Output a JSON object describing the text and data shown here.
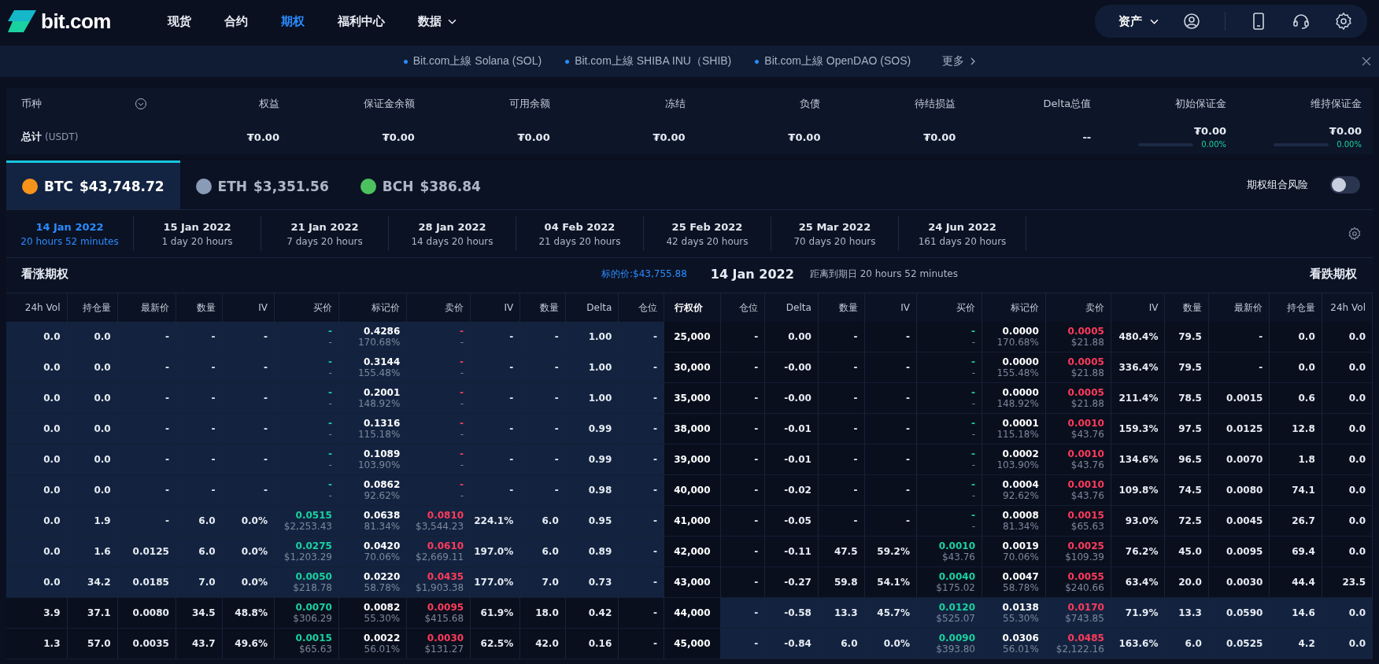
{
  "nav": {
    "logo": "bit.com",
    "items": [
      {
        "label": "现货",
        "selected": false,
        "dropdown": false
      },
      {
        "label": "合约",
        "selected": false,
        "dropdown": false
      },
      {
        "label": "期权",
        "selected": true,
        "dropdown": false
      },
      {
        "label": "福利中心",
        "selected": false,
        "dropdown": false
      },
      {
        "label": "数据",
        "selected": false,
        "dropdown": true
      }
    ],
    "assets": "资产"
  },
  "ticker": {
    "items": [
      "Bit.com上線 Solana (SOL)",
      "Bit.com上線 SHIBA INU（SHIB)",
      "Bit.com上線 OpenDAO (SOS)"
    ],
    "more": "更多"
  },
  "summary": {
    "headers": [
      "币种",
      "权益",
      "保证金余额",
      "可用余额",
      "冻结",
      "负债",
      "待结损益",
      "Delta总值",
      "初始保证金",
      "维持保证金"
    ],
    "total_label": "总计",
    "total_unit": "(USDT)",
    "values": [
      {
        "value": "₮0.00"
      },
      {
        "value": "₮0.00"
      },
      {
        "value": "₮0.00"
      },
      {
        "value": "₮0.00"
      },
      {
        "value": "₮0.00"
      },
      {
        "value": "₮0.00"
      },
      {
        "value": "--"
      },
      {
        "value": "₮0.00",
        "ratio": "0.00%",
        "level": 0
      },
      {
        "value": "₮0.00",
        "ratio": "0.00%",
        "level": 0
      }
    ]
  },
  "currencies": [
    {
      "symbol": "BTC",
      "price": "$43,748.72",
      "selected": true,
      "color": "#f7931a"
    },
    {
      "symbol": "ETH",
      "price": "$3,351.56",
      "selected": false,
      "color": "#8a9bb8"
    },
    {
      "symbol": "BCH",
      "price": "$386.84",
      "selected": false,
      "color": "#4cc25f"
    }
  ],
  "combo_risk": {
    "label": "期权组合风险",
    "on": false
  },
  "expiries": [
    {
      "date": "14 Jan 2022",
      "remaining": "20 hours 52 minutes",
      "selected": true
    },
    {
      "date": "15 Jan 2022",
      "remaining": "1 day 20 hours",
      "selected": false
    },
    {
      "date": "21 Jan 2022",
      "remaining": "7 days 20 hours",
      "selected": false
    },
    {
      "date": "28 Jan 2022",
      "remaining": "14 days 20 hours",
      "selected": false
    },
    {
      "date": "04 Feb 2022",
      "remaining": "21 days 20 hours",
      "selected": false
    },
    {
      "date": "25 Feb 2022",
      "remaining": "42 days 20 hours",
      "selected": false
    },
    {
      "date": "25 Mar 2022",
      "remaining": "70 days 20 hours",
      "selected": false
    },
    {
      "date": "24 Jun 2022",
      "remaining": "161 days 20 hours",
      "selected": false
    }
  ],
  "chain_header": {
    "calls_title": "看涨期权",
    "underlying": "标的价:$43,755.88",
    "expiry": "14 Jan 2022",
    "countdown": "距离到期日 20 hours 52 minutes",
    "puts_title": "看跌期权"
  },
  "call_columns": [
    {
      "label": "24h Vol",
      "kind": "plain"
    },
    {
      "label": "持仓量",
      "kind": "plain"
    },
    {
      "label": "最新价",
      "kind": "plain"
    },
    {
      "label": "数量",
      "kind": "plain"
    },
    {
      "label": "IV",
      "kind": "plain"
    },
    {
      "label": "买价",
      "kind": "bid"
    },
    {
      "label": "标记价",
      "kind": "mark"
    },
    {
      "label": "卖价",
      "kind": "ask"
    },
    {
      "label": "IV",
      "kind": "plain"
    },
    {
      "label": "数量",
      "kind": "plain"
    },
    {
      "label": "Delta",
      "kind": "plain"
    },
    {
      "label": "仓位",
      "kind": "plain"
    }
  ],
  "strike_column": "行权价",
  "put_columns": [
    {
      "label": "仓位",
      "kind": "plain"
    },
    {
      "label": "Delta",
      "kind": "plain"
    },
    {
      "label": "数量",
      "kind": "plain"
    },
    {
      "label": "IV",
      "kind": "plain"
    },
    {
      "label": "买价",
      "kind": "bid"
    },
    {
      "label": "标记价",
      "kind": "mark"
    },
    {
      "label": "卖价",
      "kind": "ask"
    },
    {
      "label": "IV",
      "kind": "plain"
    },
    {
      "label": "数量",
      "kind": "plain"
    },
    {
      "label": "最新价",
      "kind": "plain"
    },
    {
      "label": "持仓量",
      "kind": "plain"
    },
    {
      "label": "24h Vol",
      "kind": "plain"
    }
  ],
  "rows": [
    {
      "strike": "25,000",
      "call_itm": true,
      "put_itm": false,
      "call": [
        "0.0",
        "0.0",
        "-",
        "-",
        "-",
        [
          "-",
          "-"
        ],
        [
          "0.4286",
          "170.68%"
        ],
        [
          "-",
          "-"
        ],
        "-",
        "-",
        "1.00",
        "-"
      ],
      "put": [
        "-",
        "0.00",
        "-",
        "-",
        [
          "-",
          "-"
        ],
        [
          "0.0000",
          "170.68%"
        ],
        [
          "0.0005",
          "$21.88"
        ],
        "480.4%",
        "79.5",
        "-",
        "0.0",
        "0.0"
      ]
    },
    {
      "strike": "30,000",
      "call_itm": true,
      "put_itm": false,
      "call": [
        "0.0",
        "0.0",
        "-",
        "-",
        "-",
        [
          "-",
          "-"
        ],
        [
          "0.3144",
          "155.48%"
        ],
        [
          "-",
          "-"
        ],
        "-",
        "-",
        "1.00",
        "-"
      ],
      "put": [
        "-",
        "-0.00",
        "-",
        "-",
        [
          "-",
          "-"
        ],
        [
          "0.0000",
          "155.48%"
        ],
        [
          "0.0005",
          "$21.88"
        ],
        "336.4%",
        "79.5",
        "-",
        "0.0",
        "0.0"
      ]
    },
    {
      "strike": "35,000",
      "call_itm": true,
      "put_itm": false,
      "call": [
        "0.0",
        "0.0",
        "-",
        "-",
        "-",
        [
          "-",
          "-"
        ],
        [
          "0.2001",
          "148.92%"
        ],
        [
          "-",
          "-"
        ],
        "-",
        "-",
        "1.00",
        "-"
      ],
      "put": [
        "-",
        "-0.00",
        "-",
        "-",
        [
          "-",
          "-"
        ],
        [
          "0.0000",
          "148.92%"
        ],
        [
          "0.0005",
          "$21.88"
        ],
        "211.4%",
        "78.5",
        "0.0015",
        "0.6",
        "0.0"
      ]
    },
    {
      "strike": "38,000",
      "call_itm": true,
      "put_itm": false,
      "call": [
        "0.0",
        "0.0",
        "-",
        "-",
        "-",
        [
          "-",
          "-"
        ],
        [
          "0.1316",
          "115.18%"
        ],
        [
          "-",
          "-"
        ],
        "-",
        "-",
        "0.99",
        "-"
      ],
      "put": [
        "-",
        "-0.01",
        "-",
        "-",
        [
          "-",
          "-"
        ],
        [
          "0.0001",
          "115.18%"
        ],
        [
          "0.0010",
          "$43.76"
        ],
        "159.3%",
        "97.5",
        "0.0125",
        "12.8",
        "0.0"
      ]
    },
    {
      "strike": "39,000",
      "call_itm": true,
      "put_itm": false,
      "call": [
        "0.0",
        "0.0",
        "-",
        "-",
        "-",
        [
          "-",
          "-"
        ],
        [
          "0.1089",
          "103.90%"
        ],
        [
          "-",
          "-"
        ],
        "-",
        "-",
        "0.99",
        "-"
      ],
      "put": [
        "-",
        "-0.01",
        "-",
        "-",
        [
          "-",
          "-"
        ],
        [
          "0.0002",
          "103.90%"
        ],
        [
          "0.0010",
          "$43.76"
        ],
        "134.6%",
        "96.5",
        "0.0070",
        "1.8",
        "0.0"
      ]
    },
    {
      "strike": "40,000",
      "call_itm": true,
      "put_itm": false,
      "call": [
        "0.0",
        "0.0",
        "-",
        "-",
        "-",
        [
          "-",
          "-"
        ],
        [
          "0.0862",
          "92.62%"
        ],
        [
          "-",
          "-"
        ],
        "-",
        "-",
        "0.98",
        "-"
      ],
      "put": [
        "-",
        "-0.02",
        "-",
        "-",
        [
          "-",
          "-"
        ],
        [
          "0.0004",
          "92.62%"
        ],
        [
          "0.0010",
          "$43.76"
        ],
        "109.8%",
        "74.5",
        "0.0080",
        "74.1",
        "0.0"
      ]
    },
    {
      "strike": "41,000",
      "call_itm": true,
      "put_itm": false,
      "call": [
        "0.0",
        "1.9",
        "-",
        "6.0",
        "0.0%",
        [
          "0.0515",
          "$2,253.43"
        ],
        [
          "0.0638",
          "81.34%"
        ],
        [
          "0.0810",
          "$3,544.23"
        ],
        "224.1%",
        "6.0",
        "0.95",
        "-"
      ],
      "put": [
        "-",
        "-0.05",
        "-",
        "-",
        [
          "-",
          "-"
        ],
        [
          "0.0008",
          "81.34%"
        ],
        [
          "0.0015",
          "$65.63"
        ],
        "93.0%",
        "72.5",
        "0.0045",
        "26.7",
        "0.0"
      ]
    },
    {
      "strike": "42,000",
      "call_itm": true,
      "put_itm": false,
      "call": [
        "0.0",
        "1.6",
        "0.0125",
        "6.0",
        "0.0%",
        [
          "0.0275",
          "$1,203.29"
        ],
        [
          "0.0420",
          "70.06%"
        ],
        [
          "0.0610",
          "$2,669.11"
        ],
        "197.0%",
        "6.0",
        "0.89",
        "-"
      ],
      "put": [
        "-",
        "-0.11",
        "47.5",
        "59.2%",
        [
          "0.0010",
          "$43.76"
        ],
        [
          "0.0019",
          "70.06%"
        ],
        [
          "0.0025",
          "$109.39"
        ],
        "76.2%",
        "45.0",
        "0.0095",
        "69.4",
        "0.0"
      ]
    },
    {
      "strike": "43,000",
      "call_itm": true,
      "put_itm": false,
      "call": [
        "0.0",
        "34.2",
        "0.0185",
        "7.0",
        "0.0%",
        [
          "0.0050",
          "$218.78"
        ],
        [
          "0.0220",
          "58.78%"
        ],
        [
          "0.0435",
          "$1,903.38"
        ],
        "177.0%",
        "7.0",
        "0.73",
        "-"
      ],
      "put": [
        "-",
        "-0.27",
        "59.8",
        "54.1%",
        [
          "0.0040",
          "$175.02"
        ],
        [
          "0.0047",
          "58.78%"
        ],
        [
          "0.0055",
          "$240.66"
        ],
        "63.4%",
        "20.0",
        "0.0030",
        "44.4",
        "23.5"
      ]
    },
    {
      "strike": "44,000",
      "call_itm": false,
      "put_itm": true,
      "call": [
        "3.9",
        "37.1",
        "0.0080",
        "34.5",
        "48.8%",
        [
          "0.0070",
          "$306.29"
        ],
        [
          "0.0082",
          "55.30%"
        ],
        [
          "0.0095",
          "$415.68"
        ],
        "61.9%",
        "18.0",
        "0.42",
        "-"
      ],
      "put": [
        "-",
        "-0.58",
        "13.3",
        "45.7%",
        [
          "0.0120",
          "$525.07"
        ],
        [
          "0.0138",
          "55.30%"
        ],
        [
          "0.0170",
          "$743.85"
        ],
        "71.9%",
        "13.3",
        "0.0590",
        "14.6",
        "0.0"
      ]
    },
    {
      "strike": "45,000",
      "call_itm": false,
      "put_itm": true,
      "call": [
        "1.3",
        "57.0",
        "0.0035",
        "43.7",
        "49.6%",
        [
          "0.0015",
          "$65.63"
        ],
        [
          "0.0022",
          "56.01%"
        ],
        [
          "0.0030",
          "$131.27"
        ],
        "62.5%",
        "42.0",
        "0.16",
        "-"
      ],
      "put": [
        "-",
        "-0.84",
        "6.0",
        "0.0%",
        [
          "0.0090",
          "$393.80"
        ],
        [
          "0.0306",
          "56.01%"
        ],
        [
          "0.0485",
          "$2,122.16"
        ],
        "163.6%",
        "6.0",
        "0.0525",
        "4.2",
        "0.0"
      ]
    }
  ]
}
